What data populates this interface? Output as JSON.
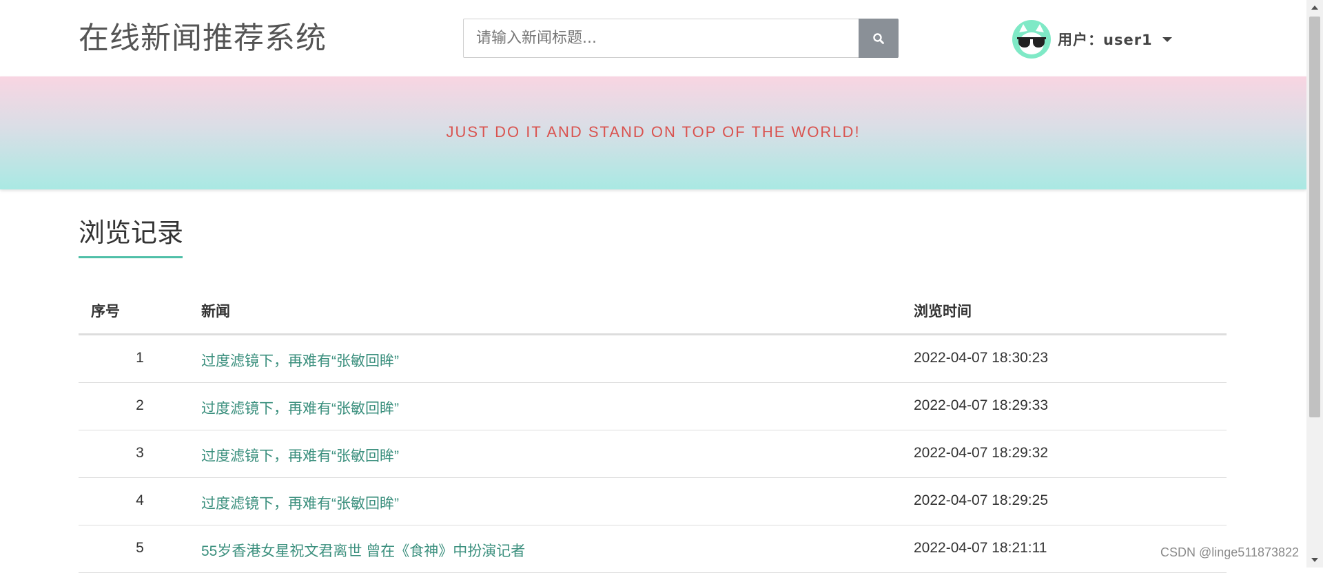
{
  "header": {
    "site_title": "在线新闻推荐系统",
    "search_placeholder": "请输入新闻标题...",
    "search_icon": "search-icon",
    "user_label": "用户：user1",
    "avatar_icon": "sunglasses-avatar-icon"
  },
  "banner": {
    "text": "JUST DO IT AND STAND ON TOP OF THE WORLD!"
  },
  "section": {
    "title": "浏览记录"
  },
  "table": {
    "headers": {
      "num": "序号",
      "news": "新闻",
      "time": "浏览时间"
    },
    "rows": [
      {
        "num": "1",
        "news": "过度滤镜下，再难有“张敏回眸”",
        "time": "2022-04-07 18:30:23"
      },
      {
        "num": "2",
        "news": "过度滤镜下，再难有“张敏回眸”",
        "time": "2022-04-07 18:29:33"
      },
      {
        "num": "3",
        "news": "过度滤镜下，再难有“张敏回眸”",
        "time": "2022-04-07 18:29:32"
      },
      {
        "num": "4",
        "news": "过度滤镜下，再难有“张敏回眸”",
        "time": "2022-04-07 18:29:25"
      },
      {
        "num": "5",
        "news": "55岁香港女星祝文君离世 曾在《食神》中扮演记者",
        "time": "2022-04-07 18:21:11"
      }
    ]
  },
  "watermark": "CSDN @linge511873822",
  "colors": {
    "accent": "#4fbfa8",
    "link": "#3a8f7d",
    "banner_text": "#d9534f",
    "search_button": "#8a9097",
    "avatar_bg": "#7fe9c6"
  }
}
